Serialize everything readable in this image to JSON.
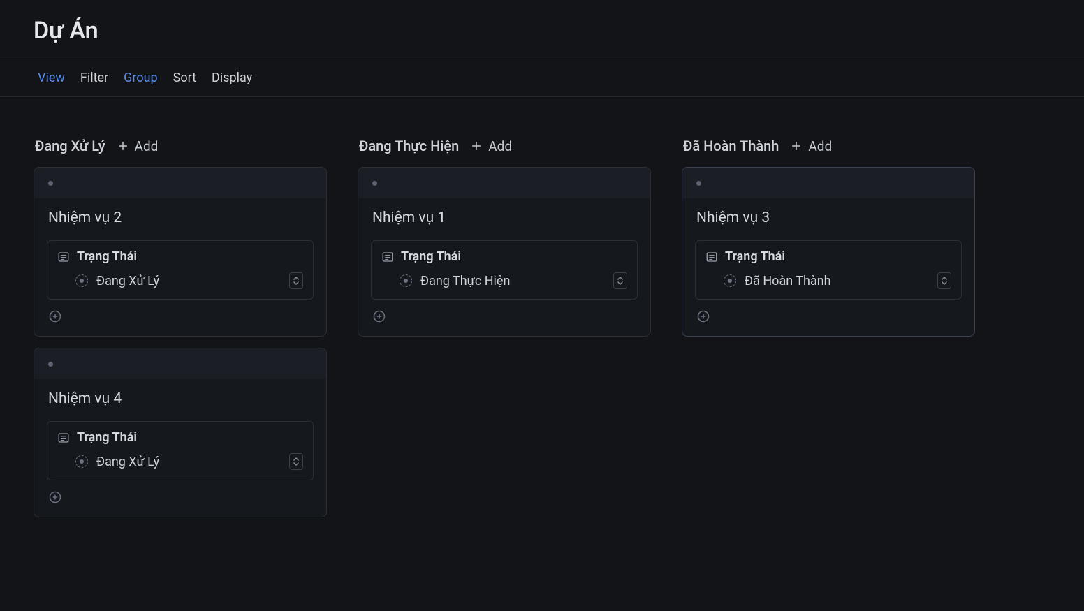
{
  "header": {
    "title": "Dự Án"
  },
  "toolbar": {
    "view": "View",
    "filter": "Filter",
    "group": "Group",
    "sort": "Sort",
    "display": "Display"
  },
  "addLabel": "Add",
  "propLabel": "Trạng Thái",
  "columns": [
    {
      "title": "Đang Xử Lý",
      "cards": [
        {
          "title": "Nhiệm vụ 2",
          "status": "Đang Xử Lý",
          "active": false
        },
        {
          "title": "Nhiệm vụ 4",
          "status": "Đang Xử Lý",
          "active": false
        }
      ]
    },
    {
      "title": "Đang Thực Hiện",
      "cards": [
        {
          "title": "Nhiệm vụ 1",
          "status": "Đang Thực Hiện",
          "active": false
        }
      ]
    },
    {
      "title": "Đã Hoàn Thành",
      "cards": [
        {
          "title": "Nhiệm vụ 3",
          "status": "Đã Hoàn Thành",
          "active": true
        }
      ]
    }
  ]
}
